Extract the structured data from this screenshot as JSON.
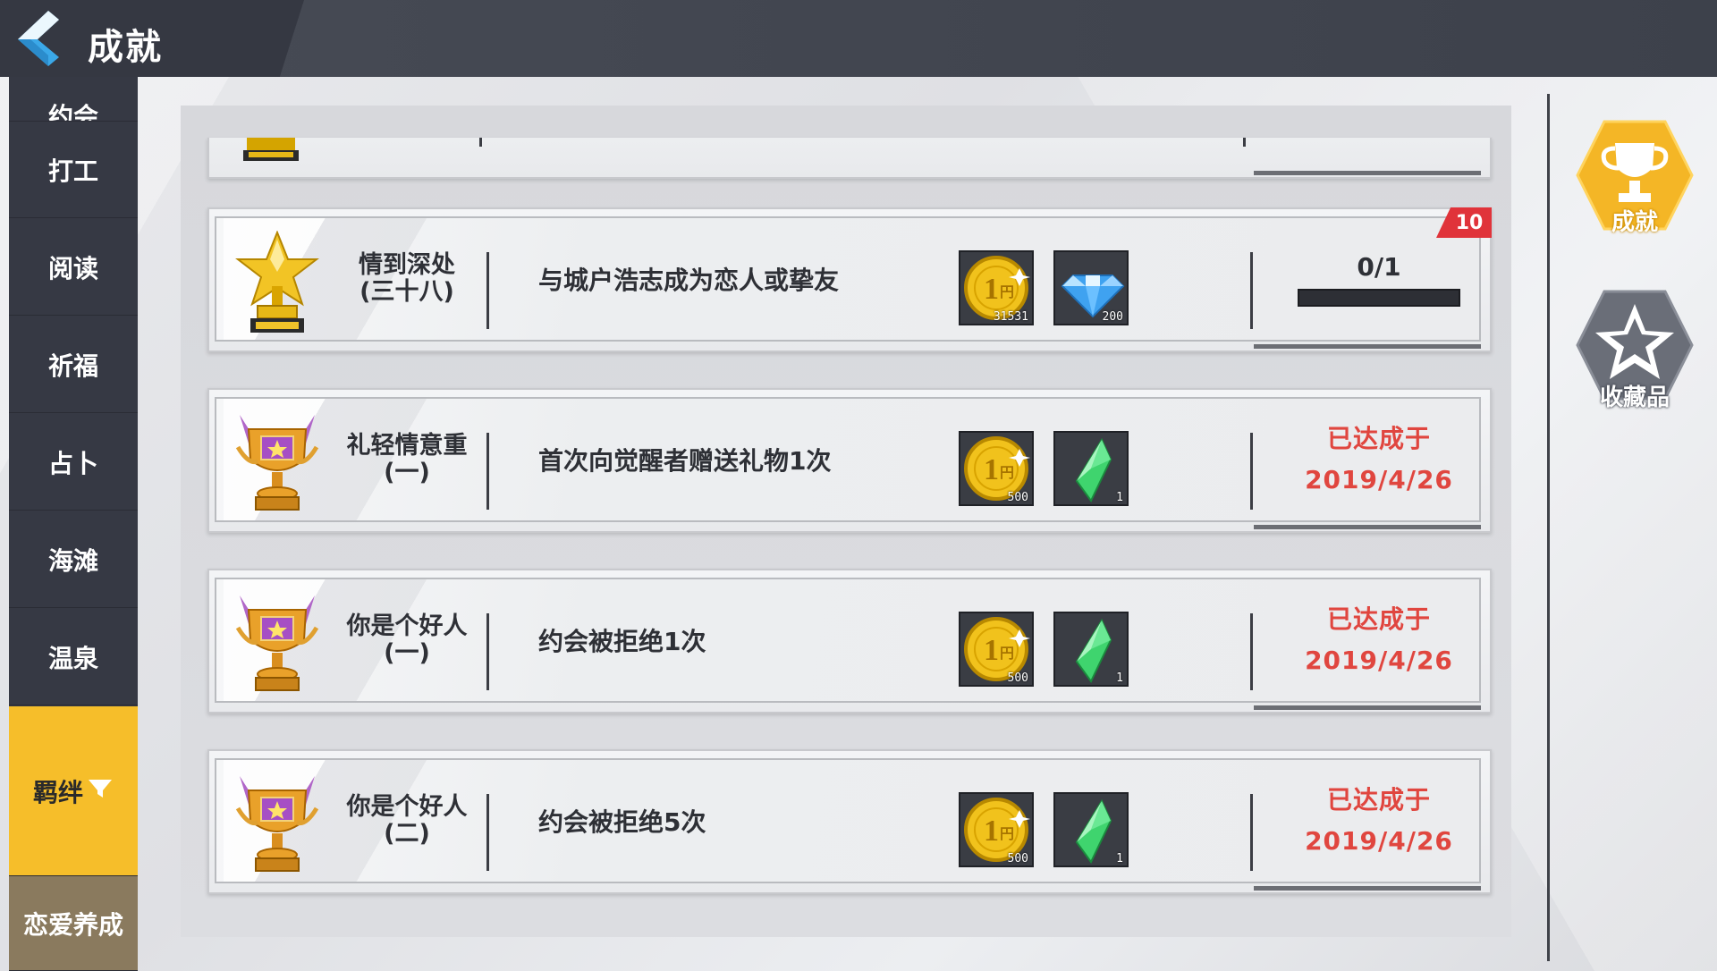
{
  "header": {
    "title": "成就"
  },
  "sidebar": {
    "items": [
      {
        "label": "约会",
        "state": "partial"
      },
      {
        "label": "打工"
      },
      {
        "label": "阅读"
      },
      {
        "label": "祈福"
      },
      {
        "label": "占卜"
      },
      {
        "label": "海滩"
      },
      {
        "label": "温泉"
      },
      {
        "label": "羁绊",
        "state": "active"
      },
      {
        "label": "恋爱养成"
      }
    ]
  },
  "achievements": [
    {
      "name_line1": "情到深处",
      "name_line2": "(三十八)",
      "description": "与城户浩志成为恋人或挚友",
      "trophy": "gold-star-trophy-icon",
      "rewards": [
        {
          "icon": "gold-coin-icon",
          "count": "31531"
        },
        {
          "icon": "blue-diamond-icon",
          "count": "200"
        }
      ],
      "status": "progress",
      "progress_text": "0/1",
      "progress": 0,
      "badge": "10"
    },
    {
      "name_line1": "礼轻情意重",
      "name_line2": "(一)",
      "description": "首次向觉醒者赠送礼物1次",
      "trophy": "purple-gold-trophy-icon",
      "rewards": [
        {
          "icon": "gold-coin-icon",
          "count": "500"
        },
        {
          "icon": "green-crystal-icon",
          "count": "1"
        }
      ],
      "status": "done",
      "done_label": "已达成于",
      "done_date": "2019/4/26"
    },
    {
      "name_line1": "你是个好人",
      "name_line2": "(一)",
      "description": "约会被拒绝1次",
      "trophy": "purple-gold-trophy-icon",
      "rewards": [
        {
          "icon": "gold-coin-icon",
          "count": "500"
        },
        {
          "icon": "green-crystal-icon",
          "count": "1"
        }
      ],
      "status": "done",
      "done_label": "已达成于",
      "done_date": "2019/4/26"
    },
    {
      "name_line1": "你是个好人",
      "name_line2": "(二)",
      "description": "约会被拒绝5次",
      "trophy": "purple-gold-trophy-icon",
      "rewards": [
        {
          "icon": "gold-coin-icon",
          "count": "500"
        },
        {
          "icon": "green-crystal-icon",
          "count": "1"
        }
      ],
      "status": "done",
      "done_label": "已达成于",
      "done_date": "2019/4/26"
    }
  ],
  "right_nav": {
    "achievement_label": "成就",
    "collection_label": "收藏品"
  },
  "colors": {
    "accent_yellow": "#f6be2a",
    "done_red": "#e0463f",
    "badge_red": "#e0333a",
    "dark_bar": "#363944"
  }
}
